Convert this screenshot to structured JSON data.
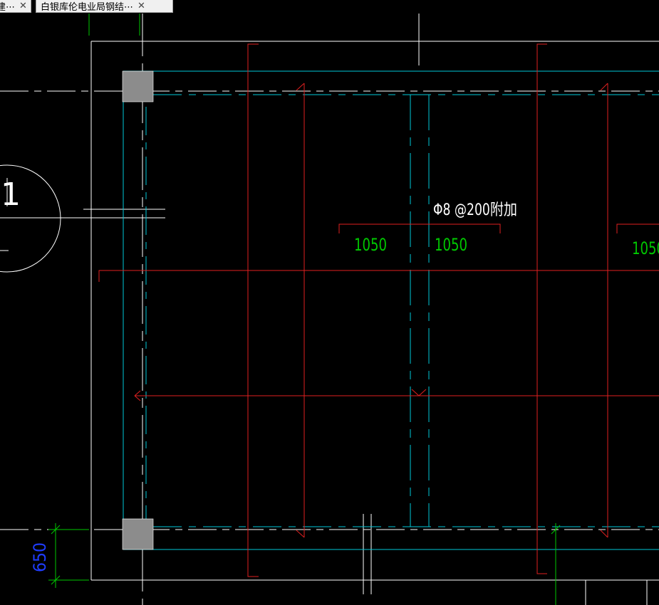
{
  "tabs": [
    {
      "label": "建⋯",
      "close": "✕"
    },
    {
      "label": "白银库伦电业局钢结⋯",
      "close": "✕"
    }
  ],
  "drawing": {
    "axis_bubble_label": "1",
    "rebar_note": "Φ8 @200附加",
    "dim_left": "1050",
    "dim_mid": "1050",
    "dim_right": "1050",
    "dim_vertical": "650"
  },
  "colors": {
    "background": "#000000",
    "outline": "#ffffff",
    "beam": "#00c8d8",
    "rebar": "#e02020",
    "dimension": "#00c800",
    "dimension_vertical": "#1f3cff",
    "column": "#8c8c8c"
  }
}
